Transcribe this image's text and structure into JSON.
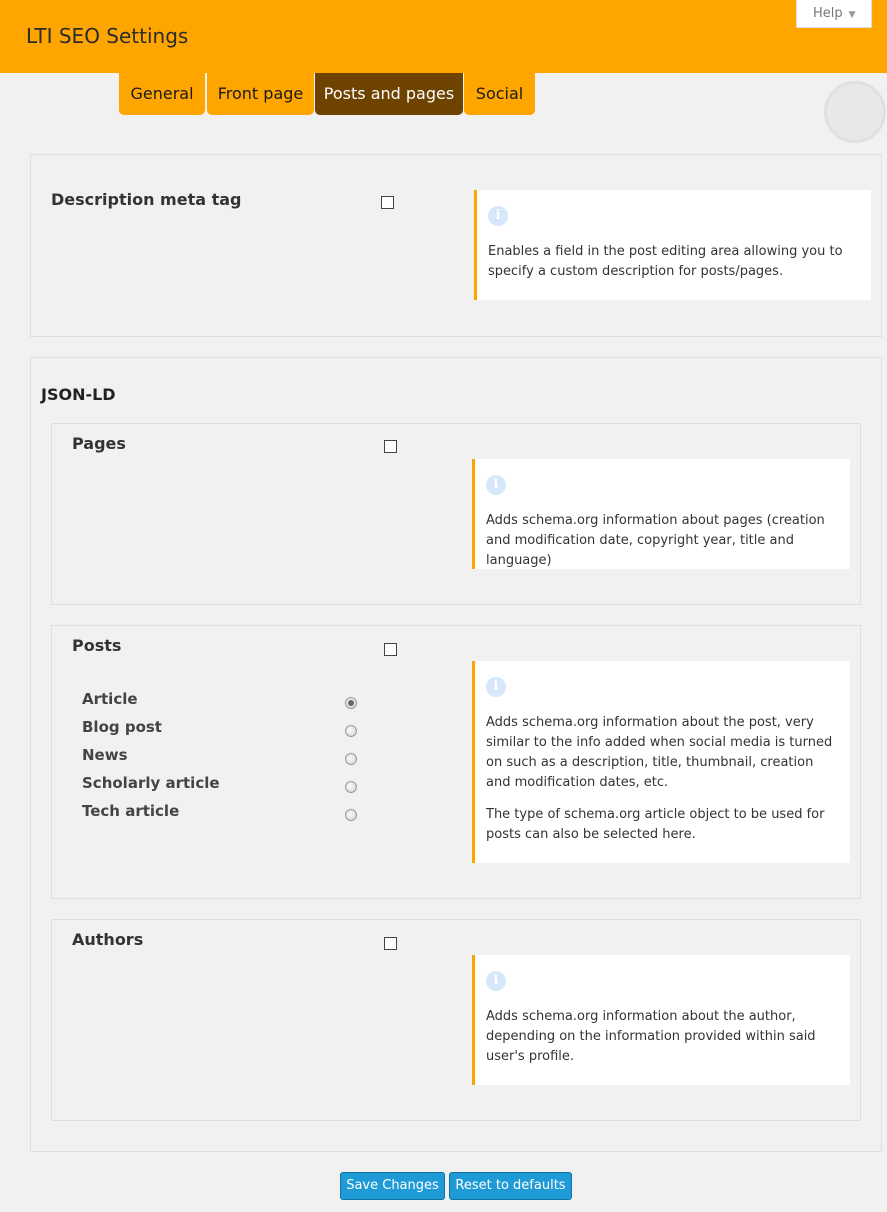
{
  "header": {
    "title": "LTI SEO Settings",
    "help_label": "Help",
    "help_arrow": "▼"
  },
  "tabs": [
    {
      "label": "General"
    },
    {
      "label": "Front page"
    },
    {
      "label": "Posts and pages",
      "active": true
    },
    {
      "label": "Social"
    }
  ],
  "description_meta": {
    "label": "Description meta tag",
    "checked": false,
    "info": "Enables a field in the post editing area allowing you to specify a custom description for posts/pages."
  },
  "jsonld": {
    "title": "JSON-LD",
    "pages": {
      "label": "Pages",
      "checked": false,
      "info": "Adds schema.org information about pages (creation and modification date, copyright year, title and language)"
    },
    "posts": {
      "label": "Posts",
      "checked": false,
      "types": [
        {
          "label": "Article",
          "selected": true
        },
        {
          "label": "Blog post",
          "selected": false
        },
        {
          "label": "News",
          "selected": false
        },
        {
          "label": "Scholarly article",
          "selected": false
        },
        {
          "label": "Tech article",
          "selected": false
        }
      ],
      "info_p1": "Adds schema.org information about the post, very similar to the info added when social media is turned on such as a description, title, thumbnail, creation and modification dates, etc.",
      "info_p2": "The type of schema.org article object to be used for posts can also be selected here."
    },
    "authors": {
      "label": "Authors",
      "checked": false,
      "info": "Adds schema.org information about the author, depending on the information provided within said user's profile."
    }
  },
  "icons": {
    "info": "i"
  },
  "buttons": {
    "save": "Save Changes",
    "reset": "Reset to defaults"
  },
  "colors": {
    "accent": "#ffa500",
    "active_tab": "#6e4300",
    "button": "#1e9bd7"
  }
}
